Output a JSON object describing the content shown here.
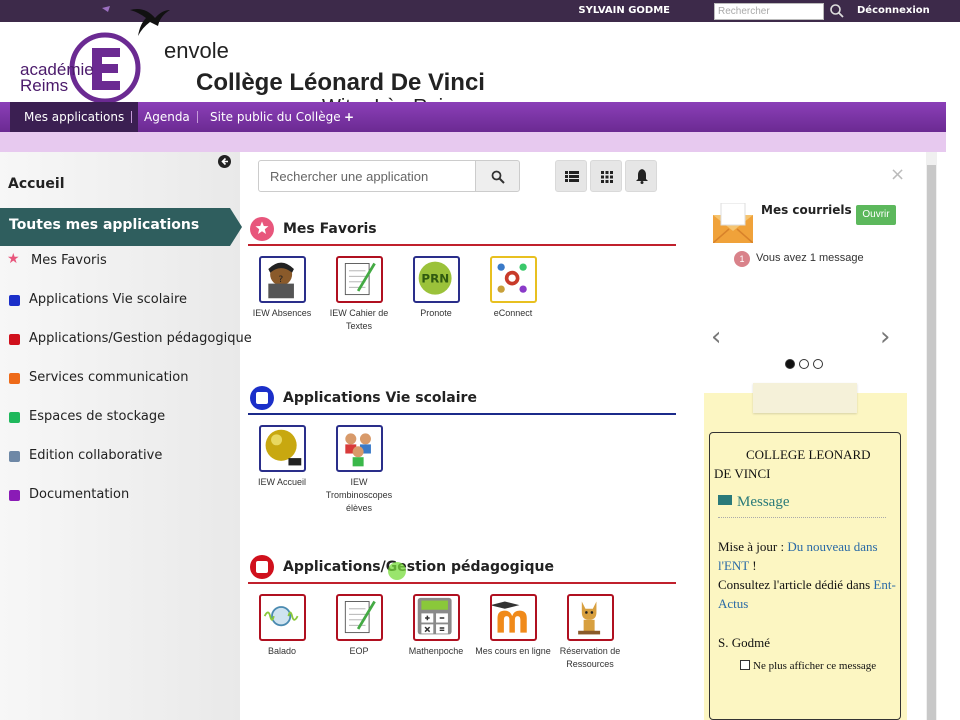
{
  "topbar": {
    "username": "SYLVAIN GODME",
    "search_placeholder": "Rechercher",
    "logout": "Déconnexion"
  },
  "header": {
    "academie": "académie\nReims",
    "envole": "envole",
    "college": "Collège Léonard De Vinci",
    "city": "Witry-Lès-Reims"
  },
  "nav": {
    "items": [
      "Mes applications",
      "Agenda",
      "Site public du Collège",
      "+"
    ]
  },
  "sidebar": {
    "home": "Accueil",
    "all_apps": "Toutes mes applications",
    "categories": [
      {
        "label": "Mes Favoris",
        "color": "#e8567c"
      },
      {
        "label": "Applications Vie scolaire",
        "color": "#1b2fc9"
      },
      {
        "label": "Applications/Gestion pédagogique",
        "color": "#d0101c"
      },
      {
        "label": "Services communication",
        "color": "#ee6a18"
      },
      {
        "label": "Espaces de stockage",
        "color": "#1fb85c"
      },
      {
        "label": "Edition collaborative",
        "color": "#6e88a6"
      },
      {
        "label": "Documentation",
        "color": "#8a1bb6"
      }
    ]
  },
  "main": {
    "search_placeholder": "Rechercher une application",
    "sections": [
      {
        "title": "Mes Favoris",
        "color": "#e8567c",
        "line": "#c0202c",
        "apps": [
          {
            "name": "IEW Absences",
            "border": "#2a2e8a"
          },
          {
            "name": "IEW Cahier de Textes",
            "border": "#b01020"
          },
          {
            "name": "Pronote",
            "border": "#2a2e8a"
          },
          {
            "name": "eConnect",
            "border": "#e8c020"
          }
        ]
      },
      {
        "title": "Applications Vie scolaire",
        "color": "#1b2fc9",
        "line": "#1b2a8a",
        "apps": [
          {
            "name": "IEW Accueil",
            "border": "#2a2e8a"
          },
          {
            "name": "IEW Trombinoscopes élèves",
            "border": "#2a2e8a"
          }
        ]
      },
      {
        "title": "Applications/Gestion pédagogique",
        "color": "#d0101c",
        "line": "#c0202c",
        "apps": [
          {
            "name": "Balado",
            "border": "#b01020"
          },
          {
            "name": "EOP",
            "border": "#b01020"
          },
          {
            "name": "Mathenpoche",
            "border": "#b01020"
          },
          {
            "name": "Mes cours en ligne",
            "border": "#b01020"
          },
          {
            "name": "Réservation de Ressources",
            "border": "#b01020"
          }
        ]
      }
    ]
  },
  "right": {
    "close": "×",
    "mail_title": "Mes courriels",
    "open_btn": "Ouvrir",
    "msg_count": "1",
    "msg_text": "Vous avez 1 message",
    "arrow_left": "‹",
    "arrow_right": "›",
    "note": {
      "title_line1": "COLLEGE LEONARD",
      "title_line2": "DE VINCI",
      "message_label": "Message",
      "body_prefix": "Mise à jour : ",
      "body_link1": "Du nouveau dans l'ENT",
      "body_suffix1": " !",
      "body_line2": "Consultez l'article dédié dans ",
      "body_link2": "Ent-Actus",
      "signature": "S. Godmé",
      "checkbox_label": "Ne plus afficher ce message"
    }
  }
}
